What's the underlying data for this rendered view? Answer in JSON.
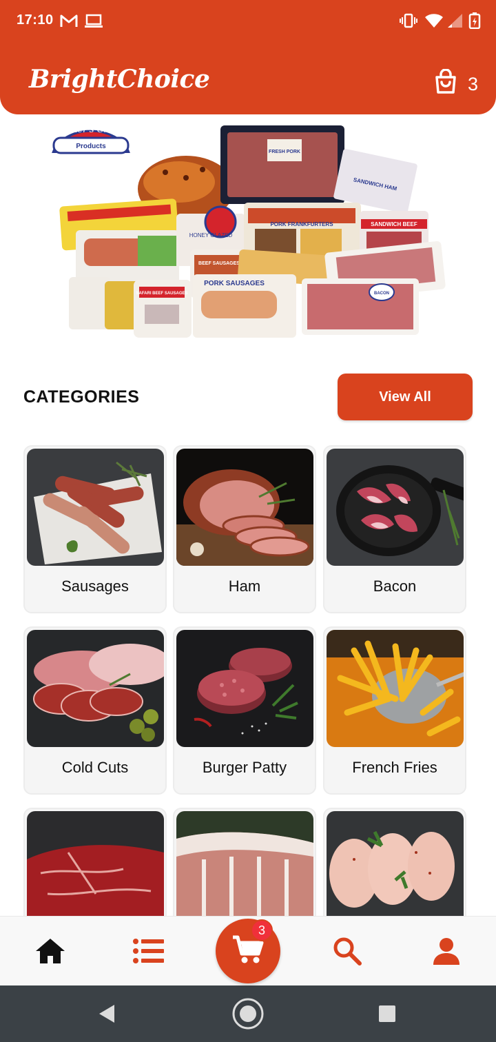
{
  "status_bar": {
    "time": "17:10",
    "icons": [
      "gmail-icon",
      "laptop-icon",
      "vibrate-icon",
      "wifi-icon",
      "signal-icon",
      "battery-charging-icon"
    ]
  },
  "header": {
    "app_title": "BrightChoice",
    "cart_count": "3",
    "cart_icon": "shopping-bag-icon",
    "background_color": "#d9431e"
  },
  "banner": {
    "logo_text": "Farmer's Choice",
    "logo_subtext": "Products",
    "labels": [
      "FRESH PORK",
      "SANDWICH HAM",
      "HONEY GLAZED",
      "PORK FRANKFURTERS",
      "SANDWICH BEEF",
      "BEEF SAUSAGES",
      "PORK SAUSAGES",
      "SAFARI BEEF SAUSAGES",
      "BACON"
    ]
  },
  "categories": {
    "title": "CATEGORIES",
    "view_all_label": "View All",
    "items": [
      {
        "label": "Sausages"
      },
      {
        "label": "Ham"
      },
      {
        "label": "Bacon"
      },
      {
        "label": "Cold Cuts"
      },
      {
        "label": "Burger Patty"
      },
      {
        "label": "French Fries"
      },
      {
        "label": ""
      },
      {
        "label": ""
      },
      {
        "label": ""
      }
    ]
  },
  "bottom_nav": {
    "items": [
      "home-icon",
      "list-icon",
      "cart-icon",
      "search-icon",
      "profile-icon"
    ],
    "cart_badge": "3",
    "accent_color": "#d9431e"
  }
}
